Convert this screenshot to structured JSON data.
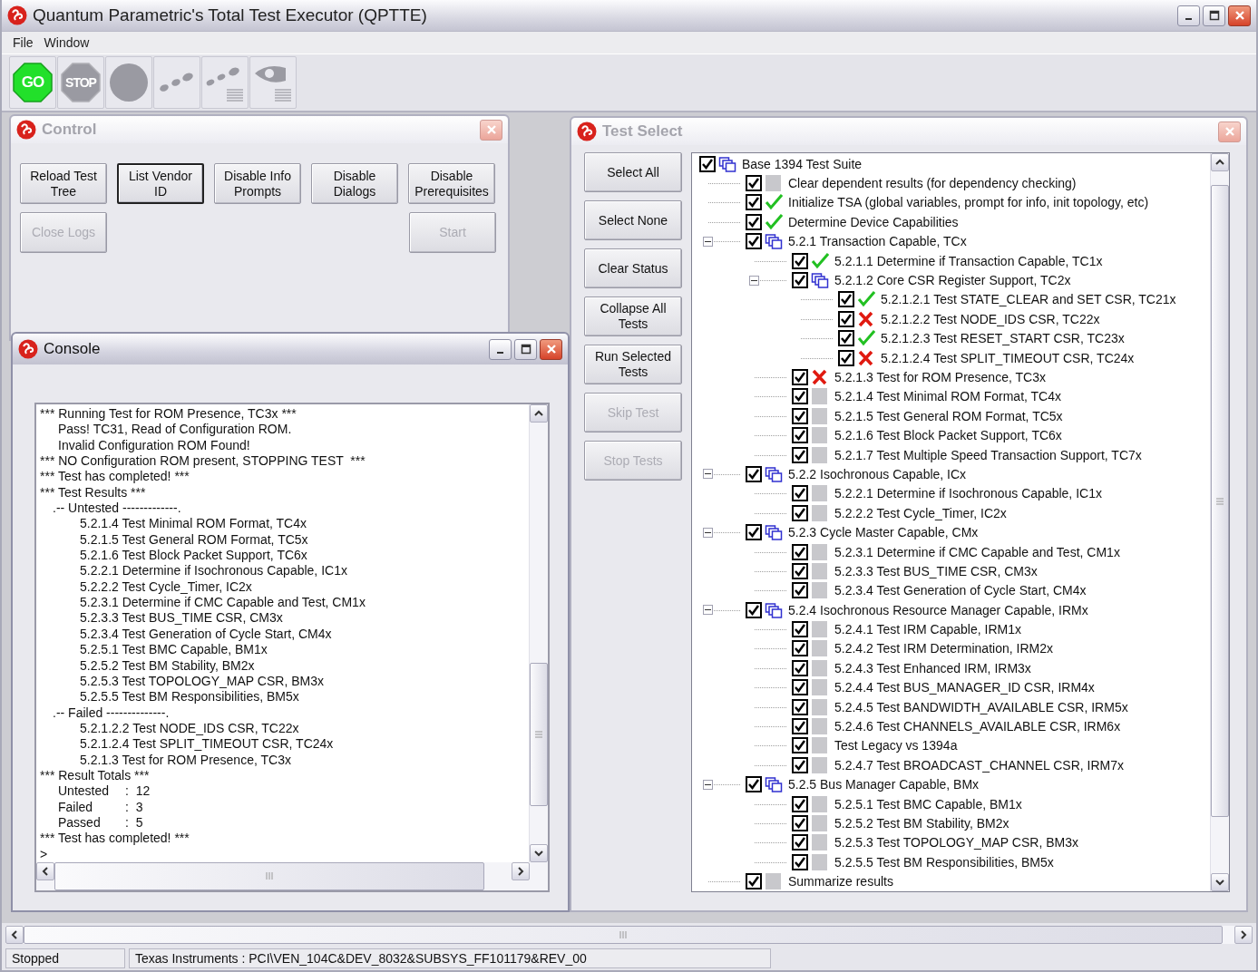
{
  "window": {
    "title": "Quantum Parametric's Total Test Executor (QPTTE)"
  },
  "menu": [
    {
      "label": "File"
    },
    {
      "label": "Window"
    }
  ],
  "toolbar": [
    {
      "kind": "go",
      "label": "GO",
      "disabled": false
    },
    {
      "kind": "stop",
      "label": "STOP",
      "disabled": true
    },
    {
      "kind": "record",
      "disabled": true
    },
    {
      "kind": "steps",
      "disabled": true
    },
    {
      "kind": "steps-log",
      "disabled": true
    },
    {
      "kind": "view-log",
      "disabled": true
    }
  ],
  "control": {
    "title": "Control",
    "active": false,
    "button_rows": [
      [
        {
          "label": "Reload Test Tree",
          "disabled": false,
          "focused": false
        },
        {
          "label": "List Vendor ID",
          "disabled": false,
          "focused": true
        },
        {
          "label": "Disable Info Prompts",
          "disabled": false,
          "focused": false
        },
        {
          "label": "Disable Dialogs",
          "disabled": false,
          "focused": false
        },
        {
          "label": "Disable Prerequisites",
          "disabled": false,
          "focused": false
        }
      ],
      [
        {
          "label": "Close Logs",
          "disabled": true,
          "focused": false
        },
        {
          "label": "Start",
          "disabled": true,
          "focused": false
        }
      ]
    ]
  },
  "test_select": {
    "title": "Test Select",
    "active": false,
    "buttons": [
      {
        "label": "Select All",
        "disabled": false
      },
      {
        "label": "Select None",
        "disabled": false
      },
      {
        "label": "Clear Status",
        "disabled": false
      },
      {
        "label": "Collapse All Tests",
        "disabled": false
      },
      {
        "label": "Run Selected Tests",
        "disabled": false
      },
      {
        "label": "Skip Test",
        "disabled": true
      },
      {
        "label": "Stop Tests",
        "disabled": true
      }
    ],
    "tree": [
      {
        "label": "Base 1394 Test Suite",
        "kind": "group",
        "checked": true,
        "children": [
          {
            "label": "Clear dependent results (for dependency checking)",
            "kind": "untested",
            "checked": true
          },
          {
            "label": "Initialize TSA (global variables, prompt for info, init topology, etc)",
            "kind": "passed",
            "checked": true
          },
          {
            "label": "Determine Device Capabilities",
            "kind": "passed",
            "checked": true
          },
          {
            "label": "5.2.1 Transaction Capable, TCx",
            "kind": "group",
            "checked": true,
            "expanded": true,
            "children": [
              {
                "label": "5.2.1.1 Determine if Transaction Capable, TC1x",
                "kind": "passed",
                "checked": true
              },
              {
                "label": "5.2.1.2 Core CSR Register Support, TC2x",
                "kind": "group",
                "checked": true,
                "expanded": true,
                "children": [
                  {
                    "label": "5.2.1.2.1 Test STATE_CLEAR and SET CSR, TC21x",
                    "kind": "passed",
                    "checked": true
                  },
                  {
                    "label": "5.2.1.2.2 Test NODE_IDS CSR, TC22x",
                    "kind": "failed",
                    "checked": true
                  },
                  {
                    "label": "5.2.1.2.3 Test RESET_START CSR, TC23x",
                    "kind": "passed",
                    "checked": true
                  },
                  {
                    "label": "5.2.1.2.4 Test SPLIT_TIMEOUT CSR, TC24x",
                    "kind": "failed",
                    "checked": true
                  }
                ]
              },
              {
                "label": "5.2.1.3 Test for ROM Presence, TC3x",
                "kind": "failed",
                "checked": true
              },
              {
                "label": "5.2.1.4 Test Minimal ROM Format, TC4x",
                "kind": "untested",
                "checked": true
              },
              {
                "label": "5.2.1.5 Test General ROM Format, TC5x",
                "kind": "untested",
                "checked": true
              },
              {
                "label": "5.2.1.6 Test Block Packet Support, TC6x",
                "kind": "untested",
                "checked": true
              },
              {
                "label": "5.2.1.7 Test Multiple Speed Transaction Support, TC7x",
                "kind": "untested",
                "checked": true
              }
            ]
          },
          {
            "label": "5.2.2 Isochronous Capable, ICx",
            "kind": "group",
            "checked": true,
            "expanded": true,
            "children": [
              {
                "label": "5.2.2.1 Determine if Isochronous Capable, IC1x",
                "kind": "untested",
                "checked": true
              },
              {
                "label": "5.2.2.2 Test Cycle_Timer, IC2x",
                "kind": "untested",
                "checked": true
              }
            ]
          },
          {
            "label": "5.2.3 Cycle Master Capable, CMx",
            "kind": "group",
            "checked": true,
            "expanded": true,
            "children": [
              {
                "label": "5.2.3.1 Determine if CMC Capable and Test, CM1x",
                "kind": "untested",
                "checked": true
              },
              {
                "label": "5.2.3.3 Test BUS_TIME CSR, CM3x",
                "kind": "untested",
                "checked": true
              },
              {
                "label": "5.2.3.4 Test Generation of Cycle Start, CM4x",
                "kind": "untested",
                "checked": true
              }
            ]
          },
          {
            "label": "5.2.4 Isochronous Resource Manager Capable, IRMx",
            "kind": "group",
            "checked": true,
            "expanded": true,
            "children": [
              {
                "label": "5.2.4.1 Test IRM Capable, IRM1x",
                "kind": "untested",
                "checked": true
              },
              {
                "label": "5.2.4.2 Test IRM Determination, IRM2x",
                "kind": "untested",
                "checked": true
              },
              {
                "label": "5.2.4.3 Test Enhanced IRM, IRM3x",
                "kind": "untested",
                "checked": true
              },
              {
                "label": "5.2.4.4 Test BUS_MANAGER_ID CSR, IRM4x",
                "kind": "untested",
                "checked": true
              },
              {
                "label": "5.2.4.5 Test BANDWIDTH_AVAILABLE CSR, IRM5x",
                "kind": "untested",
                "checked": true
              },
              {
                "label": "5.2.4.6 Test CHANNELS_AVAILABLE CSR, IRM6x",
                "kind": "untested",
                "checked": true
              },
              {
                "label": "Test Legacy vs 1394a",
                "kind": "untested",
                "checked": true
              },
              {
                "label": "5.2.4.7 Test BROADCAST_CHANNEL CSR, IRM7x",
                "kind": "untested",
                "checked": true
              }
            ]
          },
          {
            "label": "5.2.5 Bus Manager Capable, BMx",
            "kind": "group",
            "checked": true,
            "expanded": true,
            "children": [
              {
                "label": "5.2.5.1 Test BMC Capable, BM1x",
                "kind": "untested",
                "checked": true
              },
              {
                "label": "5.2.5.2 Test BM Stability, BM2x",
                "kind": "untested",
                "checked": true
              },
              {
                "label": "5.2.5.3 Test TOPOLOGY_MAP CSR, BM3x",
                "kind": "untested",
                "checked": true
              },
              {
                "label": "5.2.5.5 Test BM Responsibilities, BM5x",
                "kind": "untested",
                "checked": true
              }
            ]
          },
          {
            "label": "Summarize results",
            "kind": "untested",
            "checked": true
          }
        ]
      }
    ]
  },
  "console": {
    "title": "Console",
    "active": true,
    "lines": [
      {
        "kind": "banner",
        "text": "*** Running Test for ROM Presence, TC3x ***"
      },
      {
        "kind": "message",
        "text": "Pass! TC31, Read of Configuration ROM."
      },
      {
        "kind": "message",
        "text": "Invalid Configuration ROM Found!"
      },
      {
        "kind": "banner",
        "text": "*** NO Configuration ROM present, STOPPING TEST  ***"
      },
      {
        "kind": "banner",
        "text": "*** Test has completed! ***"
      },
      {
        "kind": "banner",
        "text": "*** Test Results ***"
      },
      {
        "kind": "section",
        "text": ".-- Untested -------------."
      },
      {
        "kind": "entry",
        "text": "5.2.1.4 Test Minimal ROM Format, TC4x"
      },
      {
        "kind": "entry",
        "text": "5.2.1.5 Test General ROM Format, TC5x"
      },
      {
        "kind": "entry",
        "text": "5.2.1.6 Test Block Packet Support, TC6x"
      },
      {
        "kind": "entry",
        "text": "5.2.2.1 Determine if Isochronous Capable, IC1x"
      },
      {
        "kind": "entry",
        "text": "5.2.2.2 Test Cycle_Timer, IC2x"
      },
      {
        "kind": "entry",
        "text": "5.2.3.1 Determine if CMC Capable and Test, CM1x"
      },
      {
        "kind": "entry",
        "text": "5.2.3.3 Test BUS_TIME CSR, CM3x"
      },
      {
        "kind": "entry",
        "text": "5.2.3.4 Test Generation of Cycle Start, CM4x"
      },
      {
        "kind": "entry",
        "text": "5.2.5.1 Test BMC Capable, BM1x"
      },
      {
        "kind": "entry",
        "text": "5.2.5.2 Test BM Stability, BM2x"
      },
      {
        "kind": "entry",
        "text": "5.2.5.3 Test TOPOLOGY_MAP CSR, BM3x"
      },
      {
        "kind": "entry",
        "text": "5.2.5.5 Test BM Responsibilities, BM5x"
      },
      {
        "kind": "section",
        "text": ".-- Failed --------------."
      },
      {
        "kind": "entry",
        "text": "5.2.1.2.2 Test NODE_IDS CSR, TC22x"
      },
      {
        "kind": "entry",
        "text": "5.2.1.2.4 Test SPLIT_TIMEOUT CSR, TC24x"
      },
      {
        "kind": "entry",
        "text": "5.2.1.3 Test for ROM Presence, TC3x"
      },
      {
        "kind": "banner",
        "text": "*** Result Totals ***"
      },
      {
        "kind": "total",
        "label": "Untested",
        "value": ":  12"
      },
      {
        "kind": "total",
        "label": "Failed",
        "value": ":  3"
      },
      {
        "kind": "total",
        "label": "Passed",
        "value": ":  5"
      },
      {
        "kind": "banner",
        "text": "*** Test has completed! ***"
      },
      {
        "kind": "banner",
        "text": ">"
      }
    ]
  },
  "status_bar": {
    "state": "Stopped",
    "device": "Texas Instruments : PCI\\VEN_104C&DEV_8032&SUBSYS_FF101179&REV_00"
  }
}
